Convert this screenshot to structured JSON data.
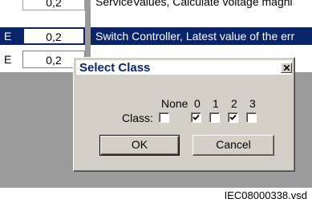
{
  "grid": {
    "rows": [
      {
        "type": "",
        "value": "0,2",
        "description": "ServiceValues, Calculate voltage magni"
      },
      {
        "type": "E",
        "value": "0,2",
        "description": "Switch Controller, Latest value of the err"
      },
      {
        "type": "E",
        "value": "0,2",
        "description": ""
      }
    ]
  },
  "dialog": {
    "title": "Select Class",
    "close_icon": "close-icon",
    "class_label": "Class:",
    "options": [
      {
        "label": "None",
        "checked": false
      },
      {
        "label": "0",
        "checked": true
      },
      {
        "label": "1",
        "checked": false
      },
      {
        "label": "2",
        "checked": true
      },
      {
        "label": "3",
        "checked": false
      }
    ],
    "ok_label": "OK",
    "cancel_label": "Cancel"
  },
  "caption": "IEC08000338.vsd",
  "colors": {
    "selection": "#0a246a",
    "dialog_face": "#d4d0c8",
    "backdrop": "#9b9b9b"
  }
}
